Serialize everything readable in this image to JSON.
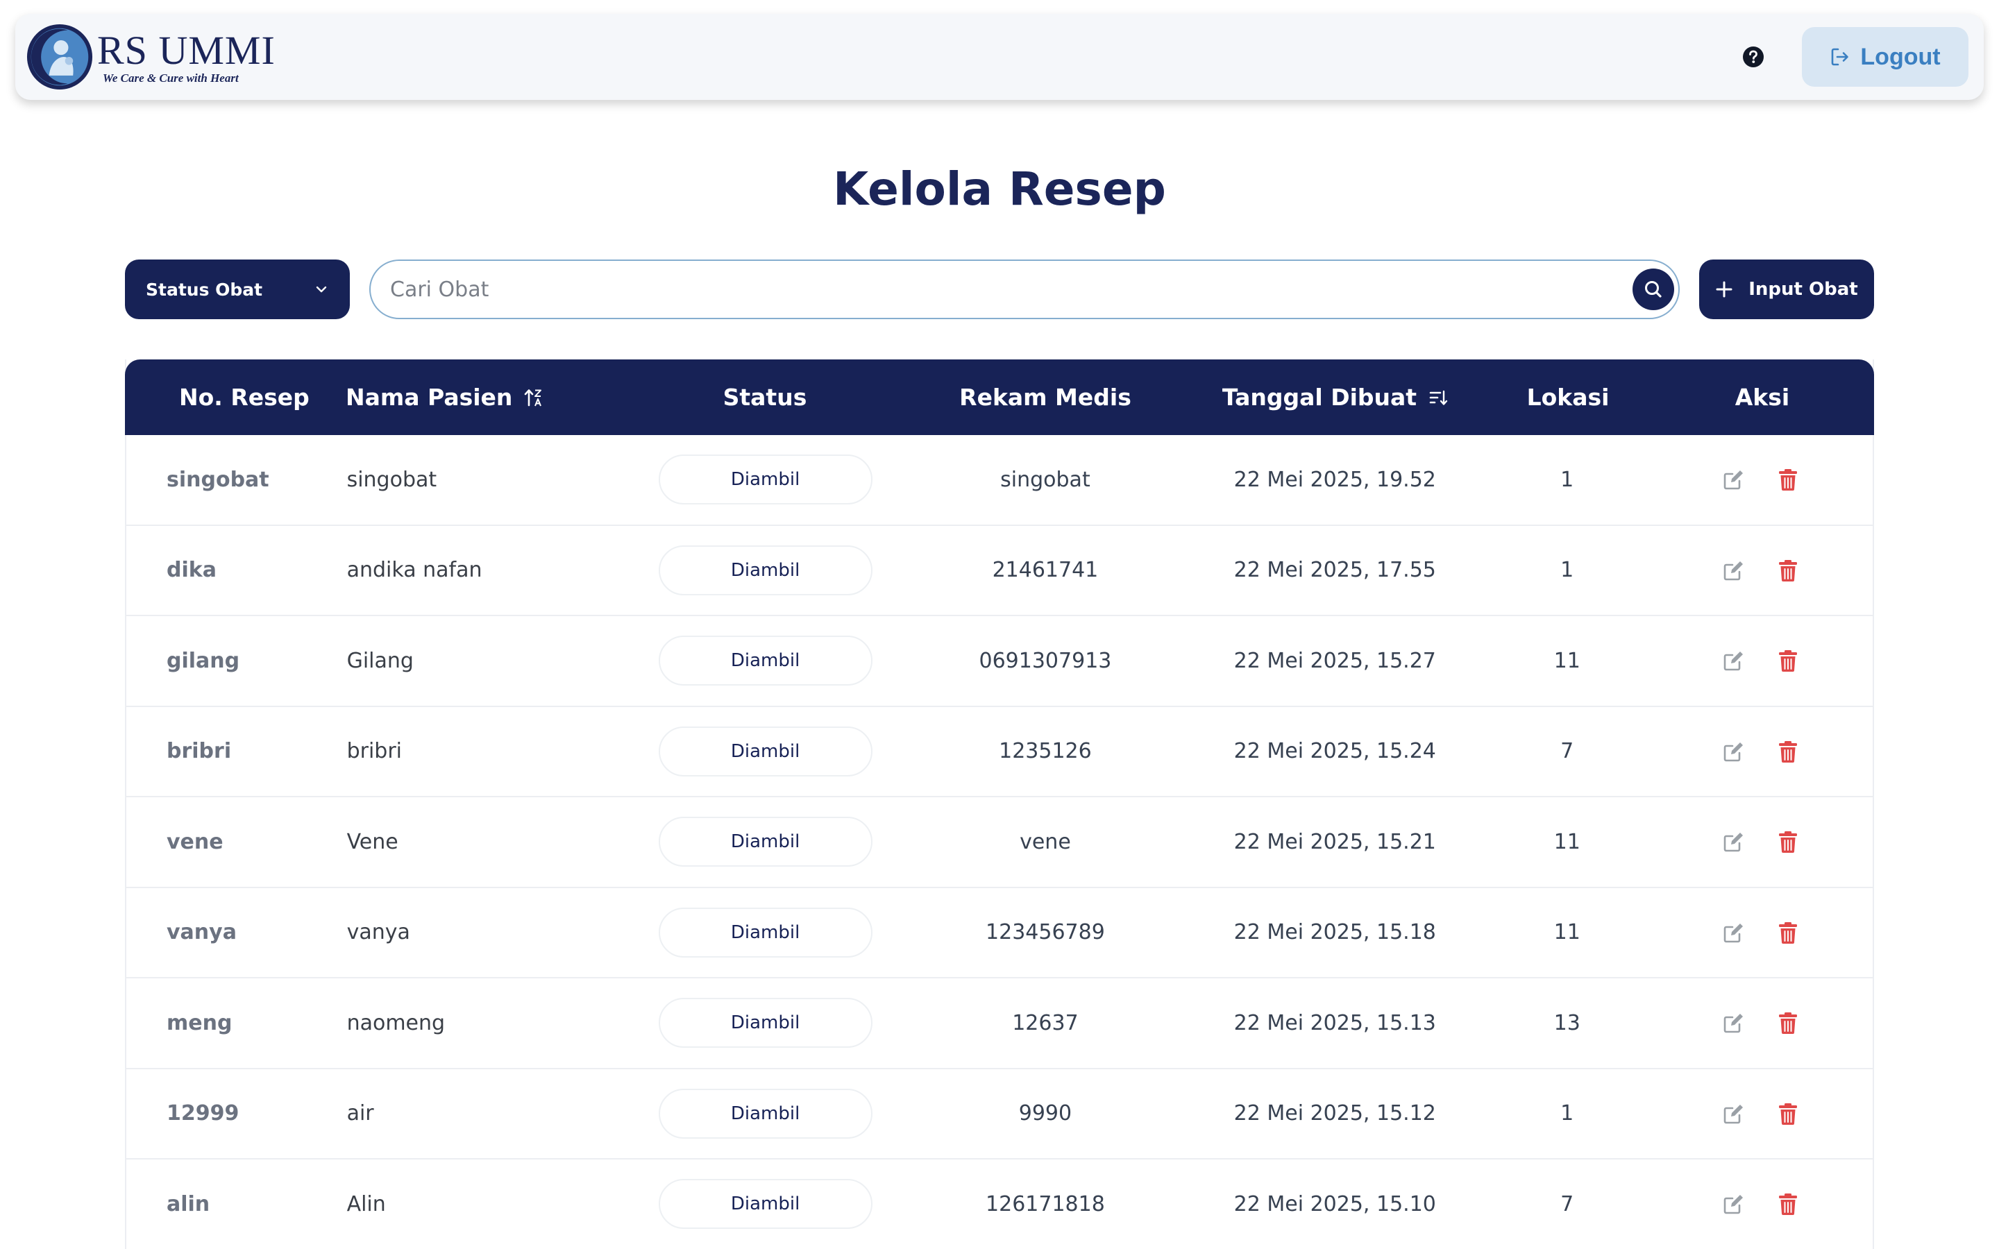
{
  "header": {
    "brand_name": "RS UMMI",
    "brand_tagline": "We Care & Cure with Heart",
    "logout_label": "Logout"
  },
  "page": {
    "title": "Kelola Resep"
  },
  "toolbar": {
    "status_filter_label": "Status Obat",
    "search_placeholder": "Cari Obat",
    "search_value": "",
    "input_button_label": "Input Obat"
  },
  "table": {
    "columns": [
      "No. Resep",
      "Nama Pasien",
      "Status",
      "Rekam Medis",
      "Tanggal Dibuat",
      "Lokasi",
      "Aksi"
    ],
    "rows": [
      {
        "no_resep": "singobat",
        "nama_pasien": "singobat",
        "status": "Diambil",
        "rekam_medis": "singobat",
        "tanggal": "22 Mei 2025, 19.52",
        "lokasi": "1"
      },
      {
        "no_resep": "dika",
        "nama_pasien": "andika nafan",
        "status": "Diambil",
        "rekam_medis": "21461741",
        "tanggal": "22 Mei 2025, 17.55",
        "lokasi": "1"
      },
      {
        "no_resep": "gilang",
        "nama_pasien": "Gilang",
        "status": "Diambil",
        "rekam_medis": "0691307913",
        "tanggal": "22 Mei 2025, 15.27",
        "lokasi": "11"
      },
      {
        "no_resep": "bribri",
        "nama_pasien": "bribri",
        "status": "Diambil",
        "rekam_medis": "1235126",
        "tanggal": "22 Mei 2025, 15.24",
        "lokasi": "7"
      },
      {
        "no_resep": "vene",
        "nama_pasien": "Vene",
        "status": "Diambil",
        "rekam_medis": "vene",
        "tanggal": "22 Mei 2025, 15.21",
        "lokasi": "11"
      },
      {
        "no_resep": "vanya",
        "nama_pasien": "vanya",
        "status": "Diambil",
        "rekam_medis": "123456789",
        "tanggal": "22 Mei 2025, 15.18",
        "lokasi": "11"
      },
      {
        "no_resep": "meng",
        "nama_pasien": "naomeng",
        "status": "Diambil",
        "rekam_medis": "12637",
        "tanggal": "22 Mei 2025, 15.13",
        "lokasi": "13"
      },
      {
        "no_resep": "12999",
        "nama_pasien": "air",
        "status": "Diambil",
        "rekam_medis": "9990",
        "tanggal": "22 Mei 2025, 15.12",
        "lokasi": "1"
      },
      {
        "no_resep": "alin",
        "nama_pasien": "Alin",
        "status": "Diambil",
        "rekam_medis": "126171818",
        "tanggal": "22 Mei 2025, 15.10",
        "lokasi": "7"
      }
    ]
  },
  "colors": {
    "navy": "#172256",
    "title": "#1b2559",
    "logout_bg": "#d8e6f3",
    "logout_text": "#3a7fc1",
    "delete": "#e04848",
    "edit": "#9aa0a6"
  },
  "icons": {
    "help": "question-circle-icon",
    "logout": "logout-icon",
    "dropdown": "chevron-down-icon",
    "search": "search-icon",
    "add": "plus-icon",
    "sort_name": "sort-alpha-icon",
    "sort_date": "sort-list-icon",
    "edit": "edit-icon",
    "delete": "trash-icon"
  }
}
